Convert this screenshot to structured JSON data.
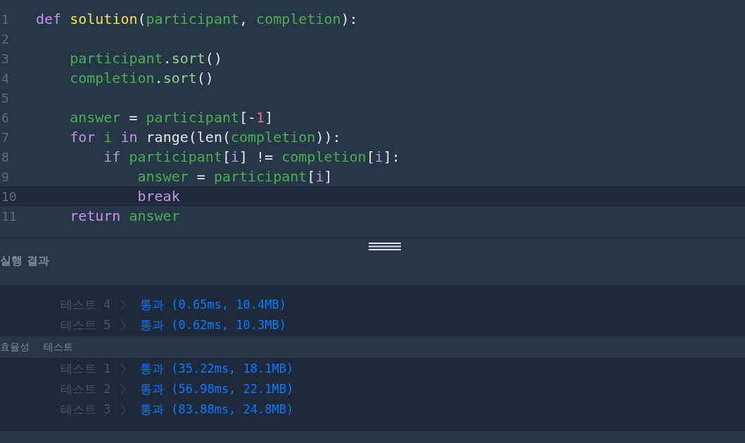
{
  "editor": {
    "lines": [
      {
        "number": "1",
        "current": false,
        "tokens": [
          {
            "kind": "keyword",
            "text": "def "
          },
          {
            "kind": "function",
            "text": "solution"
          },
          {
            "kind": "plain",
            "text": "("
          },
          {
            "kind": "name",
            "text": "participant"
          },
          {
            "kind": "plain",
            "text": ", "
          },
          {
            "kind": "name",
            "text": "completion"
          },
          {
            "kind": "plain",
            "text": "):"
          }
        ]
      },
      {
        "number": "2",
        "current": false
      },
      {
        "number": "3",
        "current": false,
        "tokens": [
          {
            "kind": "name",
            "text": "    participant"
          },
          {
            "kind": "plain",
            "text": "."
          },
          {
            "kind": "method",
            "text": "sort"
          },
          {
            "kind": "plain",
            "text": "()"
          }
        ]
      },
      {
        "number": "4",
        "current": false,
        "tokens": [
          {
            "kind": "name",
            "text": "    completion"
          },
          {
            "kind": "plain",
            "text": "."
          },
          {
            "kind": "method",
            "text": "sort"
          },
          {
            "kind": "plain",
            "text": "()"
          }
        ]
      },
      {
        "number": "5",
        "current": false
      },
      {
        "number": "6",
        "current": false,
        "tokens": [
          {
            "kind": "name",
            "text": "    answer"
          },
          {
            "kind": "plain",
            "text": " = "
          },
          {
            "kind": "name",
            "text": "participant"
          },
          {
            "kind": "plain",
            "text": "[-"
          },
          {
            "kind": "number",
            "text": "1"
          },
          {
            "kind": "plain",
            "text": "]"
          }
        ]
      },
      {
        "number": "7",
        "current": false,
        "tokens": [
          {
            "kind": "keyword",
            "text": "    for "
          },
          {
            "kind": "name",
            "text": "i "
          },
          {
            "kind": "keyword",
            "text": "in"
          },
          {
            "kind": "plain",
            "text": " range(len("
          },
          {
            "kind": "name",
            "text": "completion"
          },
          {
            "kind": "plain",
            "text": ")):"
          }
        ]
      },
      {
        "number": "8",
        "current": false,
        "tokens": [
          {
            "kind": "keyword",
            "text": "        if "
          },
          {
            "kind": "name",
            "text": "participant"
          },
          {
            "kind": "plain",
            "text": "["
          },
          {
            "kind": "index",
            "text": "i"
          },
          {
            "kind": "plain",
            "text": "] != "
          },
          {
            "kind": "name",
            "text": "completion"
          },
          {
            "kind": "plain",
            "text": "["
          },
          {
            "kind": "index",
            "text": "i"
          },
          {
            "kind": "plain",
            "text": "]:"
          }
        ]
      },
      {
        "number": "9",
        "current": false,
        "tokens": [
          {
            "kind": "name",
            "text": "            answer"
          },
          {
            "kind": "plain",
            "text": " = "
          },
          {
            "kind": "name",
            "text": "participant"
          },
          {
            "kind": "plain",
            "text": "["
          },
          {
            "kind": "index",
            "text": "i"
          },
          {
            "kind": "plain",
            "text": "]"
          }
        ]
      },
      {
        "number": "10",
        "current": true,
        "tokens": [
          {
            "kind": "keyword",
            "text": "            break"
          }
        ]
      },
      {
        "number": "11",
        "current": false,
        "tokens": [
          {
            "kind": "keyword",
            "text": "    return "
          },
          {
            "kind": "name",
            "text": "answer"
          }
        ]
      }
    ]
  },
  "output": {
    "title": "실행 결과",
    "tests": [
      {
        "label": "테스트 4",
        "result": "통과 (0.65ms, 10.4MB)"
      },
      {
        "label": "테스트 5",
        "result": "통과 (0.62ms, 10.3MB)"
      }
    ],
    "efficiency": {
      "labels": [
        "효율성",
        "테스트"
      ],
      "tests": [
        {
          "label": "테스트 1",
          "result": "통과 (35.22ms, 18.1MB)"
        },
        {
          "label": "테스트 2",
          "result": "통과 (56.98ms, 22.1MB)"
        },
        {
          "label": "테스트 3",
          "result": "통과 (83.88ms, 24.8MB)"
        }
      ]
    }
  }
}
